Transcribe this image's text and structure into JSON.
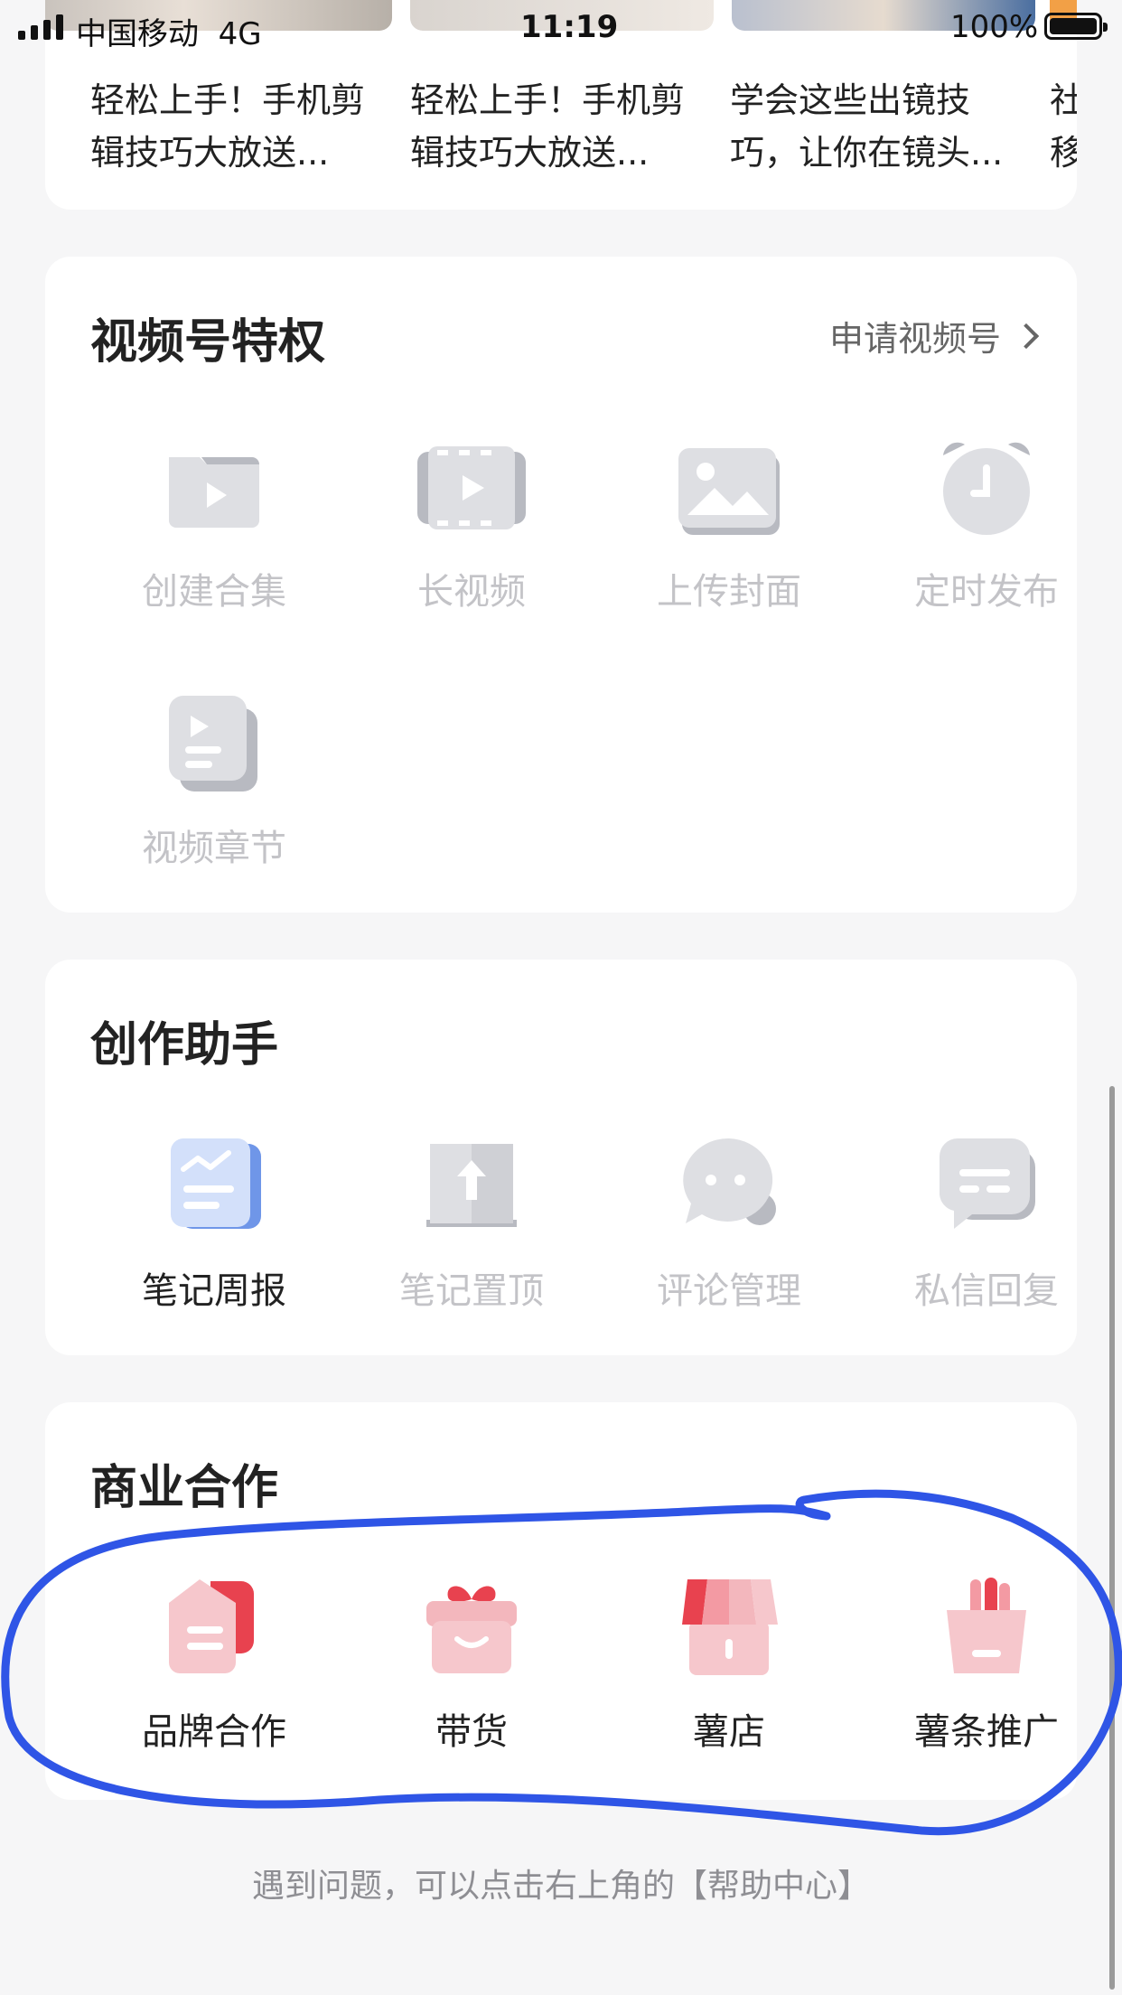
{
  "status_bar": {
    "carrier": "中国移动  4G",
    "time": "11:19",
    "battery": "100%"
  },
  "recommended_videos": [
    {
      "title": "轻松上手！手机剪\n辑技巧大放送..."
    },
    {
      "title": "轻松上手！手机剪\n辑技巧大放送..."
    },
    {
      "title": "学会这些出镜技\n巧，让你在镜头..."
    },
    {
      "title": "社\n移"
    }
  ],
  "privilege_section": {
    "title": "视频号特权",
    "apply_link": "申请视频号",
    "items": [
      {
        "label": "创建合集",
        "icon": "folder-play-icon"
      },
      {
        "label": "长视频",
        "icon": "film-icon"
      },
      {
        "label": "上传封面",
        "icon": "image-icon"
      },
      {
        "label": "定时发布",
        "icon": "alarm-clock-icon"
      },
      {
        "label": "视频章节",
        "icon": "video-chapter-icon"
      }
    ]
  },
  "assistant_section": {
    "title": "创作助手",
    "items": [
      {
        "label": "笔记周报",
        "icon": "weekly-report-icon"
      },
      {
        "label": "笔记置顶",
        "icon": "pin-to-top-icon"
      },
      {
        "label": "评论管理",
        "icon": "comment-icon"
      },
      {
        "label": "私信回复",
        "icon": "message-icon"
      }
    ]
  },
  "business_section": {
    "title": "商业合作",
    "items": [
      {
        "label": "品牌合作",
        "icon": "brand-tag-icon"
      },
      {
        "label": "带货",
        "icon": "gift-box-icon"
      },
      {
        "label": "薯店",
        "icon": "shop-icon"
      },
      {
        "label": "薯条推广",
        "icon": "fries-icon"
      }
    ]
  },
  "footer": {
    "tip": "遇到问题，可以点击右上角的【帮助中心】"
  },
  "colors": {
    "annotation": "#2f55e6",
    "accent_red": "#e8424f",
    "disabled_text": "#c3c3c7"
  }
}
